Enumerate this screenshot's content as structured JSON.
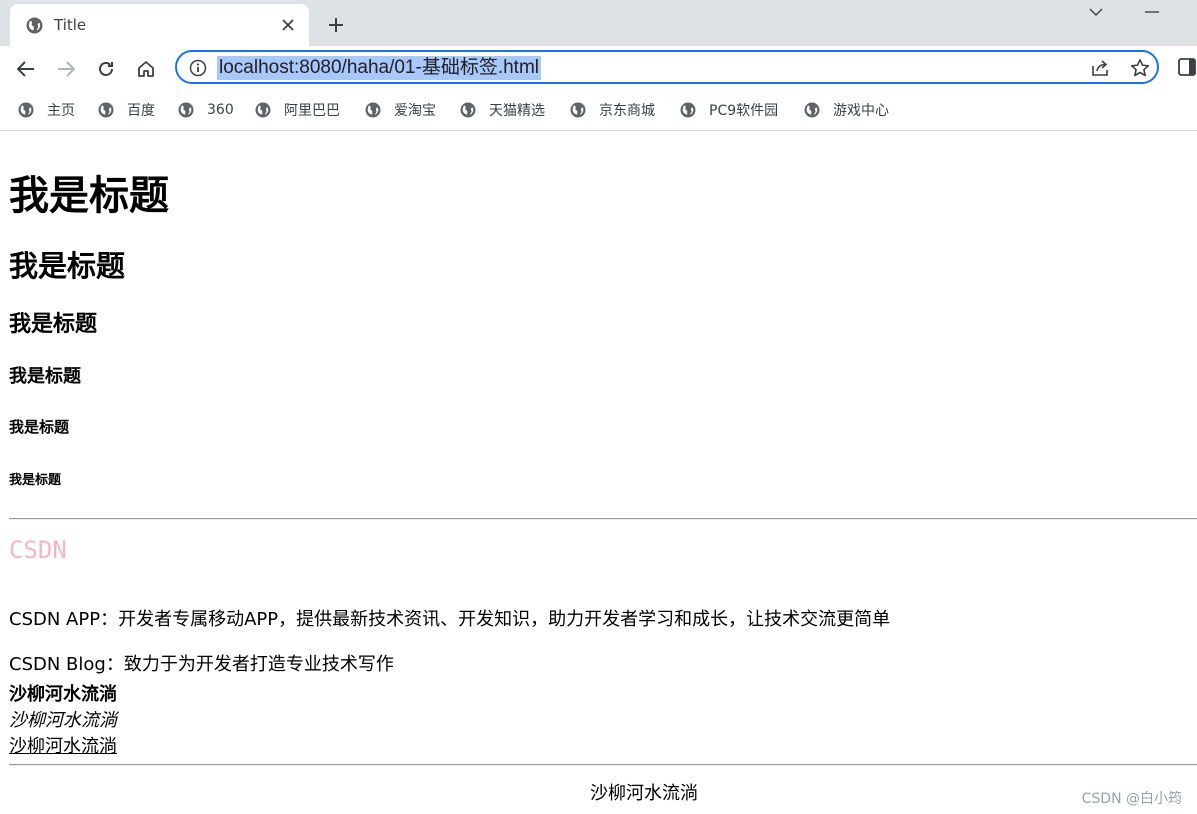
{
  "tab": {
    "title": "Title"
  },
  "omnibox": {
    "url": "localhost:8080/haha/01-基础标签.html"
  },
  "bookmarks": [
    {
      "label": "主页"
    },
    {
      "label": "百度"
    },
    {
      "label": "360"
    },
    {
      "label": "阿里巴巴"
    },
    {
      "label": "爱淘宝"
    },
    {
      "label": "天猫精选"
    },
    {
      "label": "京东商城"
    },
    {
      "label": "PC9软件园"
    },
    {
      "label": "游戏中心"
    }
  ],
  "page": {
    "headings": [
      "我是标题",
      "我是标题",
      "我是标题",
      "我是标题",
      "我是标题",
      "我是标题"
    ],
    "font_title": "CSDN",
    "font_title_color": "#f4b6c2",
    "paragraphs": [
      "CSDN APP：开发者专属移动APP，提供最新技术资讯、开发知识，助力开发者学习和成长，让技术交流更简单",
      "CSDN Blog：致力于为开发者打造专业技术写作"
    ],
    "bold_text": "沙柳河水流淌",
    "italic_text": "沙柳河水流淌",
    "underline_text": "沙柳河水流淌",
    "center_text": "沙柳河水流淌"
  },
  "watermark": "CSDN @白小筠",
  "colors": {
    "accent": "#1a73e8",
    "selection": "#a8c7fa",
    "tabstrip": "#dee1e6"
  }
}
